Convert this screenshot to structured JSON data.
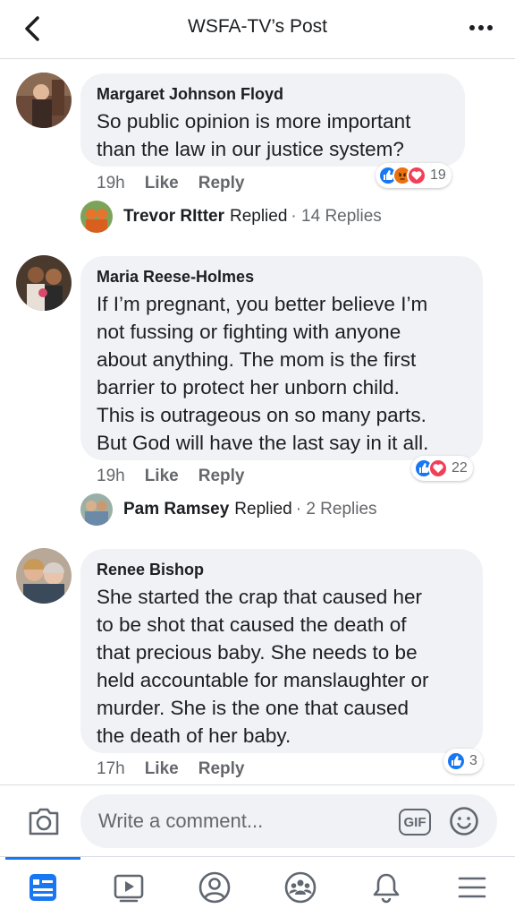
{
  "header": {
    "title": "WSFA-TV’s Post"
  },
  "comments": [
    {
      "author": "Margaret Johnson Floyd",
      "text": "So public opinion is more important\nthan the law in our justice system?",
      "time": "19h",
      "like_label": "Like",
      "reply_label": "Reply",
      "reaction_count": "19",
      "reactions": [
        "like",
        "angry",
        "love"
      ],
      "replied": {
        "name": "Trevor RItter",
        "action": "Replied",
        "count_text": "· 14 Replies"
      }
    },
    {
      "author": "Maria Reese-Holmes",
      "text": "If I’m pregnant, you better believe I’m\nnot fussing or fighting with anyone\nabout anything. The mom is the first\nbarrier to protect her unborn child.\nThis is outrageous on so many parts.\nBut God will have the last say in it all.",
      "time": "19h",
      "like_label": "Like",
      "reply_label": "Reply",
      "reaction_count": "22",
      "reactions": [
        "like",
        "love"
      ],
      "replied": {
        "name": "Pam Ramsey",
        "action": "Replied",
        "count_text": "· 2 Replies"
      }
    },
    {
      "author": "Renee Bishop",
      "text": "She started the crap that caused her\nto be shot that caused the death of\nthat precious baby.  She needs to be\nheld accountable for manslaughter or\nmurder.  She is the one that caused\nthe death of her baby.",
      "time": "17h",
      "like_label": "Like",
      "reply_label": "Reply",
      "reaction_count": "3",
      "reactions": [
        "like"
      ]
    }
  ],
  "composer": {
    "placeholder": "Write a comment...",
    "gif_label": "GIF"
  },
  "tabs": [
    {
      "icon": "news-feed-icon",
      "active": true
    },
    {
      "icon": "watch-icon",
      "active": false
    },
    {
      "icon": "profile-icon",
      "active": false
    },
    {
      "icon": "groups-icon",
      "active": false
    },
    {
      "icon": "notifications-bell-icon",
      "active": false
    },
    {
      "icon": "menu-icon",
      "active": false
    }
  ],
  "colors": {
    "accent": "#1877f2",
    "like": "#1877f2",
    "love": "#f33e58",
    "angry": "#e9710f",
    "bubble": "#f0f2f5",
    "meta_text": "#65676b"
  }
}
